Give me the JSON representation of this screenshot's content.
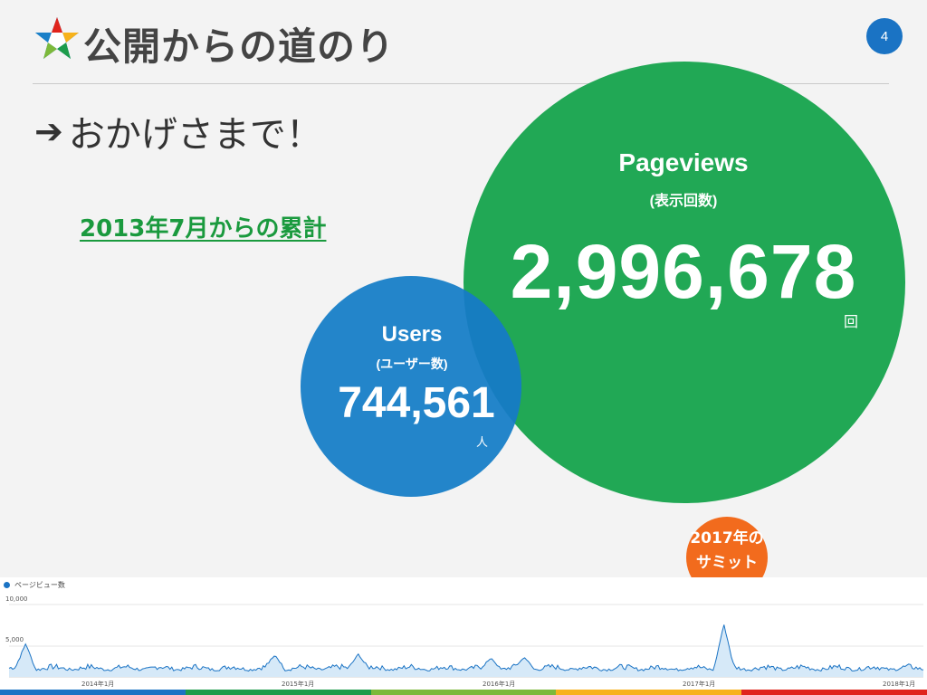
{
  "slide": {
    "title": "公開からの道のり",
    "number": "4",
    "subtitle": "おかげさまで！",
    "cumulative_label": "2013年7月からの累計"
  },
  "pageviews": {
    "label": "Pageviews",
    "sub": "(表示回数)",
    "value": "2,996,678",
    "unit": "回"
  },
  "users": {
    "label": "Users",
    "sub": "(ユーザー数)",
    "value": "744,561",
    "unit": "人"
  },
  "callout": {
    "line1": "2017年の",
    "line2": "サミット"
  },
  "colors": {
    "green": "#21a855",
    "blue": "#1a80c8",
    "orange": "#f26b1d",
    "footer": [
      "#1a73c4",
      "#1d9c4b",
      "#7cb93a",
      "#f7b21b",
      "#e0241c"
    ]
  },
  "chart_data": {
    "type": "area",
    "legend": "ページビュー数",
    "yticks": [
      "10,000",
      "5,000"
    ],
    "ylim": [
      0,
      11000
    ],
    "xticks": [
      "2014年1月",
      "2015年1月",
      "2016年1月",
      "2017年1月",
      "2018年1月"
    ],
    "xlim": [
      "2013-07",
      "2018-02"
    ],
    "baseline_range": [
      600,
      1800
    ],
    "spikes": [
      {
        "x": "2013-08",
        "value": 4600
      },
      {
        "x": "2014-11",
        "value": 3000
      },
      {
        "x": "2015-04",
        "value": 3200
      },
      {
        "x": "2015-12",
        "value": 2600
      },
      {
        "x": "2016-02",
        "value": 2700
      },
      {
        "x": "2017-02",
        "value": 7300
      }
    ]
  }
}
